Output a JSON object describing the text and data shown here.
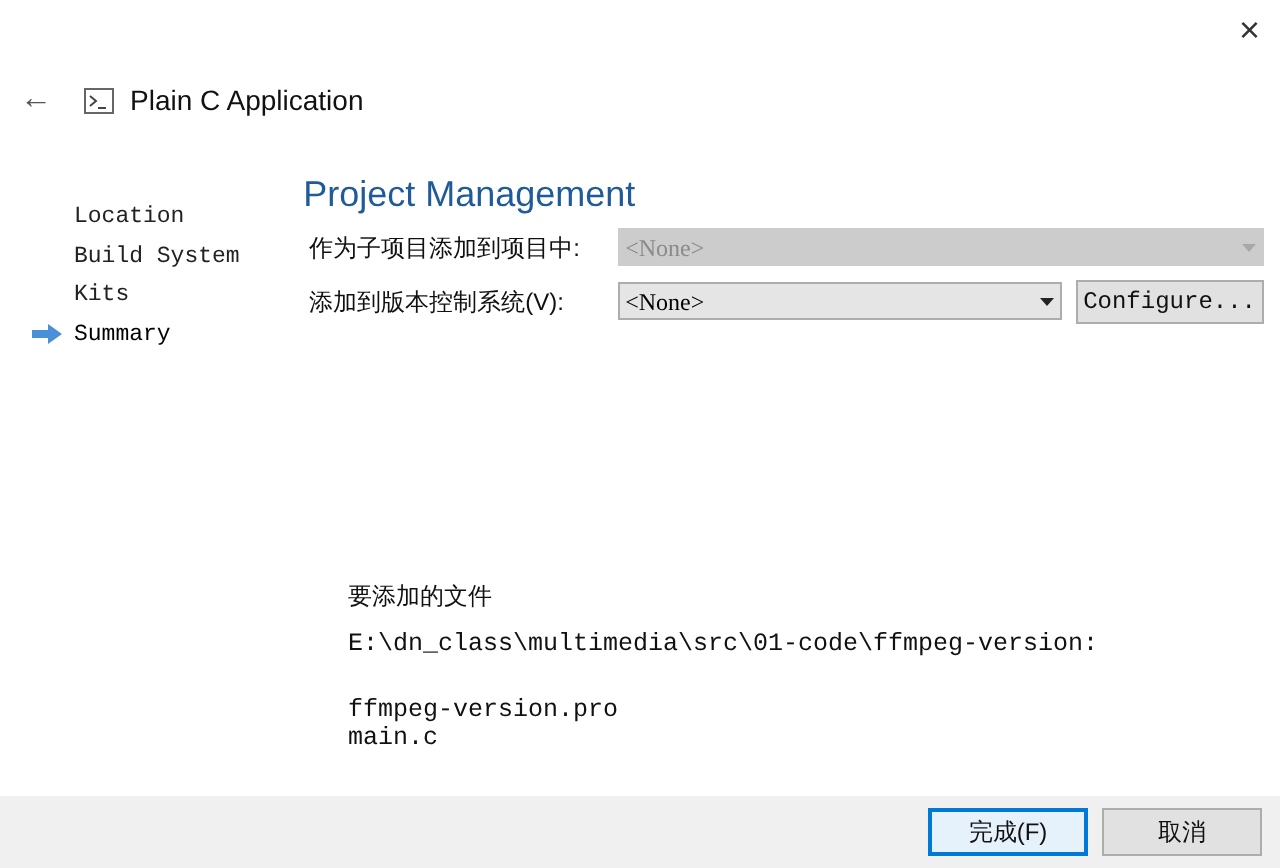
{
  "window": {
    "close": "×"
  },
  "header": {
    "back": "←",
    "title": "Plain C Application"
  },
  "steps": [
    {
      "label": "Location",
      "selected": false
    },
    {
      "label": "Build System",
      "selected": false
    },
    {
      "label": "Kits",
      "selected": false
    },
    {
      "label": "Summary",
      "selected": true
    }
  ],
  "page_title": "Project Management",
  "fields": [
    {
      "label": "作为子项目添加到项目中:",
      "value": "<None>",
      "disabled": true
    },
    {
      "label": "添加到版本控制系统(V):",
      "value": "<None>",
      "disabled": false,
      "button": "Configure..."
    }
  ],
  "files": {
    "heading": "要添加的文件",
    "path": "E:\\dn_class\\multimedia\\src\\01-code\\ffmpeg-version:",
    "items": [
      "ffmpeg-version.pro",
      "main.c"
    ]
  },
  "buttons": [
    {
      "label": "完成(F)",
      "default": true
    },
    {
      "label": "取消",
      "default": false
    }
  ]
}
